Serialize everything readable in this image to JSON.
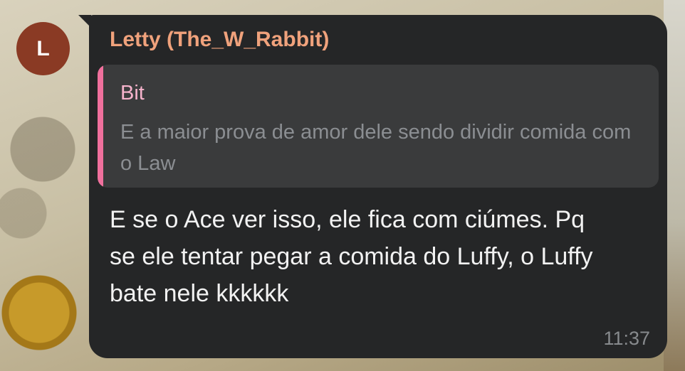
{
  "message": {
    "avatar_letter": "L",
    "sender": "Letty (The_W_Rabbit)",
    "reply": {
      "name": "Bit",
      "text": "E a maior prova de amor dele sendo dividir comida com o Law"
    },
    "text": "E se o Ace ver isso, ele fica com ciúmes. Pq se ele tentar pegar a comida do Luffy, o Luffy bate nele kkkkkk",
    "time": "11:37"
  },
  "colors": {
    "bubble": "#252627",
    "sender": "#f0a27c",
    "reply_accent": "#f0709d",
    "avatar": "#8a3a24"
  }
}
